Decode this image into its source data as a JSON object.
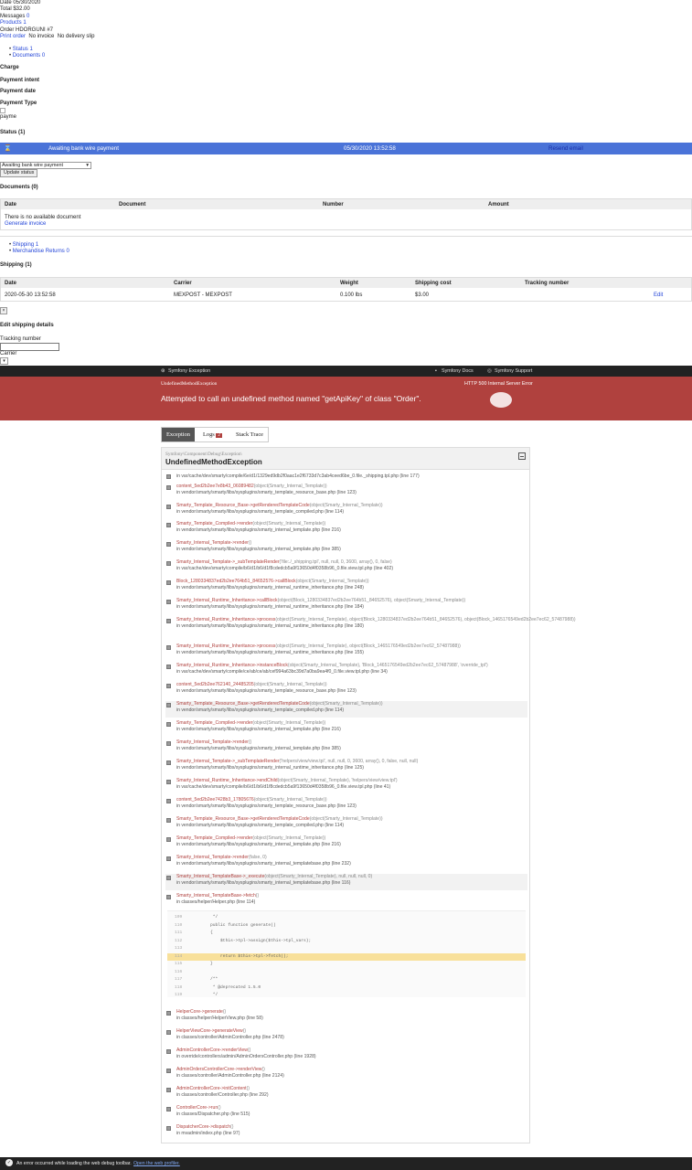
{
  "order": {
    "date": "Date 05/30/2020",
    "total": "Total $32.00",
    "messages_label": "Messages",
    "messages_count": "0",
    "products_label": "Products",
    "products_count": "1",
    "order_ref": "Order HDORGUNI #7",
    "print_order": "Print order",
    "no_invoice": "No invoice",
    "no_delivery": "No delivery slip"
  },
  "subtabs": [
    {
      "label": "Status",
      "count": "1"
    },
    {
      "label": "Documents",
      "count": "0"
    }
  ],
  "labels": {
    "charge": "Charge",
    "payment_intent": "Payment intent",
    "payment_date": "Payment date",
    "payment_type": "Payment Type",
    "payme": "payme",
    "status": "Status (1)"
  },
  "status_row": {
    "name": "Awaiting bank wire payment",
    "datetime": "05/30/2020 13:52:58",
    "resend": "Resend email"
  },
  "status_select": "Awaiting bank wire payment",
  "update_button": "Update status",
  "documents": {
    "title": "Documents (0)",
    "columns": [
      "Date",
      "Document",
      "Number",
      "Amount"
    ],
    "empty": "There is no available document",
    "generate": "Generate invoice"
  },
  "subtabs2": [
    {
      "label": "Shipping",
      "count": "1"
    },
    {
      "label": "Merchandise Returns",
      "count": "0"
    }
  ],
  "shipping": {
    "title": "Shipping (1)",
    "columns": [
      "Date",
      "Carrier",
      "Weight",
      "Shipping cost",
      "Tracking number"
    ],
    "row": {
      "date": "2020-05-30 13:52:58",
      "carrier": "MEXPOST - MEXPOST",
      "weight": "0.100 lbs",
      "cost": "$3.00",
      "edit": "Edit"
    }
  },
  "edit_shipping": {
    "title": "Edit shipping details",
    "tracking_label": "Tracking number",
    "carrier_label": "Carrier"
  },
  "symfony": {
    "brand": "Symfony Exception",
    "docs": "Symfony Docs",
    "support": "Symfony Support",
    "exception_class": "UndefinedMethodException",
    "http_status": "HTTP 500 Internal Server Error",
    "message": "Attempted to call an undefined method named \"getApiKey\" of class \"Order\"."
  },
  "tabs": {
    "exception": "Exception",
    "logs": "Logs",
    "logs_count": "2",
    "stack": "Stack Trace"
  },
  "panel": {
    "namespace": "Symfony\\Component\\Debug\\Exception\\",
    "class": "UndefinedMethodException"
  },
  "frames": [
    {
      "fn": "",
      "args": "",
      "file": "in var/cache/dev/smarty/compile/6e/d1/1329ed9db2f0aac1e2f6733d7c3ab4ceed6be_0.file._shipping.tpl.php",
      "line": "(line 177)"
    },
    {
      "fn": "content_5ed2b2ee7e8b43_06089482",
      "args": "(object(Smarty_Internal_Template))",
      "file": "in vendor/smarty/smarty/libs/sysplugins/smarty_template_resource_base.php",
      "line": "(line 123)"
    },
    {
      "fn": "Smarty_Template_Resource_Base->getRenderedTemplateCode",
      "args": "(object(Smarty_Internal_Template))",
      "file": "in vendor/smarty/smarty/libs/sysplugins/smarty_template_compiled.php",
      "line": "(line 114)"
    },
    {
      "fn": "Smarty_Template_Compiled->render",
      "args": "(object(Smarty_Internal_Template))",
      "file": "in vendor/smarty/smarty/libs/sysplugins/smarty_internal_template.php",
      "line": "(line 216)"
    },
    {
      "fn": "Smarty_Internal_Template->render",
      "args": "()",
      "file": "in vendor/smarty/smarty/libs/sysplugins/smarty_internal_template.php",
      "line": "(line 385)"
    },
    {
      "fn": "Smarty_Internal_Template->_subTemplateRender",
      "args": "('file:./_shipping.tpl', null, null, 0, 3600, array(), 0, false)",
      "file": "in var/cache/dev/smarty/compile/b6/d1/b6/d1f8cdedcb5a9f13650d4f0358b96_0.file.view.tpl.php",
      "line": "(line 402)"
    },
    {
      "fn": "Block_1280334837ed2b2ee764b51_84652576->callBlock",
      "args": "(object(Smarty_Internal_Template))",
      "file": "in vendor/smarty/smarty/libs/sysplugins/smarty_internal_runtime_inheritance.php",
      "line": "(line 248)"
    },
    {
      "fn": "Smarty_Internal_Runtime_Inheritance->callBlock",
      "args": "(object(Block_1280334837ed2b2ee764b51_84652576), object(Smarty_Internal_Template))",
      "file": "in vendor/smarty/smarty/libs/sysplugins/smarty_internal_runtime_inheritance.php",
      "line": "(line 184)"
    },
    {
      "fn": "Smarty_Internal_Runtime_Inheritance->process",
      "args": "(object(Smarty_Internal_Template), object(Block_1280334837ed2b2ee764b51_84652576), object(Block_1465176549ed2b2ee7ec62_57487988))",
      "file": "in vendor/smarty/smarty/libs/sysplugins/smarty_internal_runtime_inheritance.php",
      "line": "(line 180)"
    },
    {
      "fn": "Smarty_Internal_Runtime_Inheritance->process",
      "args": "(object(Smarty_Internal_Template), object(Block_1465176549ed2b2ee7ec62_57487988))",
      "file": "in vendor/smarty/smarty/libs/sysplugins/smarty_internal_runtime_inheritance.php",
      "line": "(line 155)"
    },
    {
      "fn": "Smarty_Internal_Runtime_Inheritance->instanceBlock",
      "args": "(object(Smarty_Internal_Template), 'Block_1465176549ed2b2ee7ec62_57487988', 'override_tpl')",
      "file": "in var/cache/dev/smarty/compile/ce/ab/ce/ab/cef994a63bc39d7a0ba9ea4f0_0.file.view.tpl.php",
      "line": "(line 34)"
    },
    {
      "fn": "content_5ed2b2ee762140_24485205",
      "args": "(object(Smarty_Internal_Template))",
      "file": "in vendor/smarty/smarty/libs/sysplugins/smarty_template_resource_base.php",
      "line": "(line 123)"
    },
    {
      "fn": "Smarty_Template_Resource_Base->getRenderedTemplateCode",
      "args": "(object(Smarty_Internal_Template))",
      "file": "in vendor/smarty/smarty/libs/sysplugins/smarty_template_compiled.php",
      "line": "(line 114)"
    },
    {
      "fn": "Smarty_Template_Compiled->render",
      "args": "(object(Smarty_Internal_Template))",
      "file": "in vendor/smarty/smarty/libs/sysplugins/smarty_internal_template.php",
      "line": "(line 216)"
    },
    {
      "fn": "Smarty_Internal_Template->render",
      "args": "()",
      "file": "in vendor/smarty/smarty/libs/sysplugins/smarty_internal_template.php",
      "line": "(line 385)"
    },
    {
      "fn": "Smarty_Internal_Template->_subTemplateRender",
      "args": "('helpers/view/view.tpl', null, null, 0, 3600, array(), 0, false, null, null)",
      "file": "in vendor/smarty/smarty/libs/sysplugins/smarty_internal_runtime_inheritance.php",
      "line": "(line 125)"
    },
    {
      "fn": "Smarty_Internal_Runtime_Inheritance->endChild",
      "args": "(object(Smarty_Internal_Template), 'helpers/view/view.tpl')",
      "file": "in var/cache/dev/smarty/compile/b6/d1/b6/d1f8cdedcb5a9f13650d4f0358b96_0.file.view.tpl.php",
      "line": "(line 41)"
    },
    {
      "fn": "content_5ed2b2ee7428b3_17805676",
      "args": "(object(Smarty_Internal_Template))",
      "file": "in vendor/smarty/smarty/libs/sysplugins/smarty_template_resource_base.php",
      "line": "(line 123)"
    },
    {
      "fn": "Smarty_Template_Resource_Base->getRenderedTemplateCode",
      "args": "(object(Smarty_Internal_Template))",
      "file": "in vendor/smarty/smarty/libs/sysplugins/smarty_template_compiled.php",
      "line": "(line 114)"
    },
    {
      "fn": "Smarty_Template_Compiled->render",
      "args": "(object(Smarty_Internal_Template))",
      "file": "in vendor/smarty/smarty/libs/sysplugins/smarty_internal_template.php",
      "line": "(line 216)"
    },
    {
      "fn": "Smarty_Internal_Template->render",
      "args": "(false, 0)",
      "file": "in vendor/smarty/smarty/libs/sysplugins/smarty_internal_templatebase.php",
      "line": "(line 232)"
    },
    {
      "fn": "Smarty_Internal_TemplateBase->_execute",
      "args": "(object(Smarty_Internal_Template), null, null, null, 0)",
      "file": "in vendor/smarty/smarty/libs/sysplugins/smarty_internal_templatebase.php",
      "line": "(line 116)"
    },
    {
      "fn": "Smarty_Internal_TemplateBase->fetch",
      "args": "()",
      "file": "in classes/helper/Helper.php",
      "line": "(line 114)"
    },
    {
      "fn": "HelperCore->generate",
      "args": "()",
      "file": "in classes/helper/HelperView.php",
      "line": "(line 58)"
    },
    {
      "fn": "HelperViewCore->generateView",
      "args": "()",
      "file": "in classes/controller/AdminController.php",
      "line": "(line 2478)"
    },
    {
      "fn": "AdminControllerCore->renderView",
      "args": "()",
      "file": "in override/controllers/admin/AdminOrdersController.php",
      "line": "(line 1928)"
    },
    {
      "fn": "AdminOrdersControllerCore->renderView",
      "args": "()",
      "file": "in classes/controller/AdminController.php",
      "line": "(line 2124)"
    },
    {
      "fn": "AdminControllerCore->initContent",
      "args": "()",
      "file": "in classes/controller/Controller.php",
      "line": "(line 292)"
    },
    {
      "fn": "ControllerCore->run",
      "args": "()",
      "file": "in classes/Dispatcher.php",
      "line": "(line 515)"
    },
    {
      "fn": "DispatcherCore->dispatch",
      "args": "()",
      "file": "in mvadmin/index.php",
      "line": "(line 97)"
    }
  ],
  "code_lines": [
    {
      "no": "109",
      "text": "     */"
    },
    {
      "no": "110",
      "text": "    public function generate()"
    },
    {
      "no": "111",
      "text": "    {"
    },
    {
      "no": "112",
      "text": "        $this->tpl->assign($this->tpl_vars);"
    },
    {
      "no": "113",
      "text": ""
    },
    {
      "no": "114",
      "text": "        return $this->tpl->fetch();"
    },
    {
      "no": "115",
      "text": "    }"
    },
    {
      "no": "116",
      "text": ""
    },
    {
      "no": "117",
      "text": "    /**"
    },
    {
      "no": "118",
      "text": "     * @deprecated 1.5.0"
    },
    {
      "no": "119",
      "text": "     */"
    }
  ],
  "toolbar": {
    "message": "An error occurred while loading the web debug toolbar.",
    "link": "Open the web profiler."
  },
  "colors": {
    "accent": "#4a73d8",
    "banner": "#b0413e",
    "highlight": "#f8e09a"
  }
}
